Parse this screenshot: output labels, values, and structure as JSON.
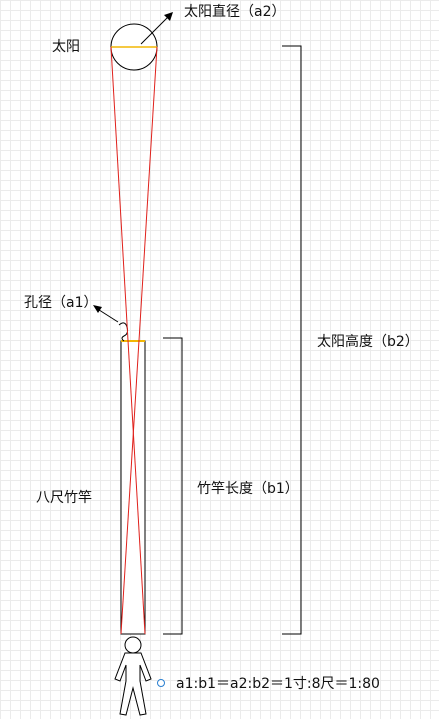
{
  "labels": {
    "sun": "太阳",
    "sun_diameter": "太阳直径（a2）",
    "aperture": "孔径（a1）",
    "sun_height": "太阳高度（b2）",
    "pole_length": "竹竿长度（b1）",
    "pole": "八尺竹竿",
    "ratio": "a1:b1＝a2:b2＝1寸:8尺＝1:80"
  },
  "colors": {
    "ray": "#e0201b",
    "diameter_line": "#f2b705",
    "stroke": "#000000"
  }
}
